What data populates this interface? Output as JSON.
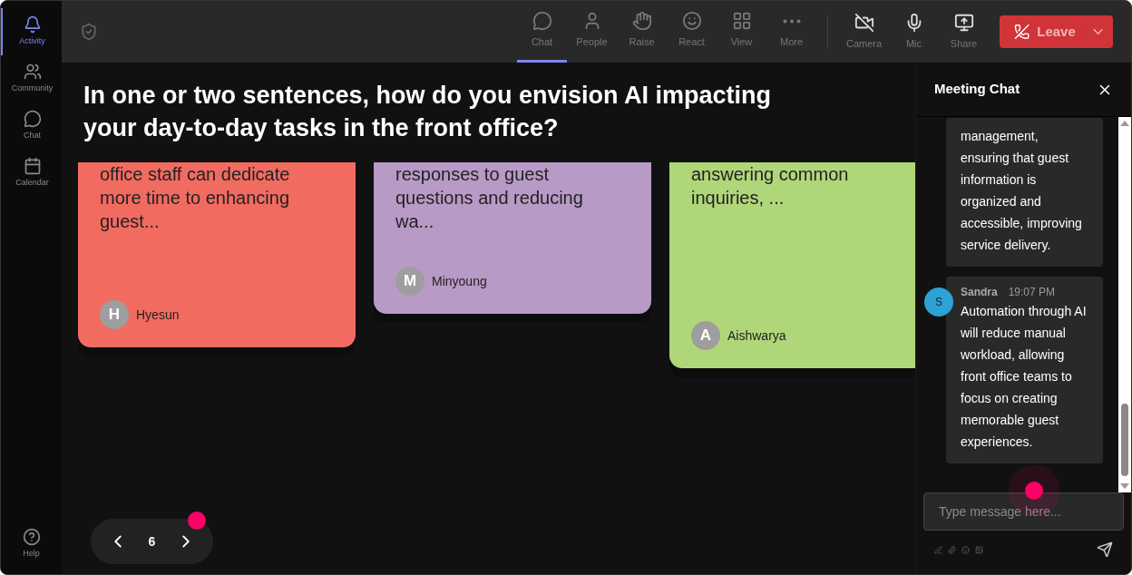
{
  "sidebar": {
    "items": [
      {
        "label": "Activity",
        "selected": true
      },
      {
        "label": "Community",
        "selected": false
      },
      {
        "label": "Chat",
        "selected": false
      },
      {
        "label": "Calendar",
        "selected": false
      }
    ],
    "help": "Help"
  },
  "toolbar": {
    "items": [
      {
        "label": "Chat",
        "selected": true
      },
      {
        "label": "People",
        "selected": false
      },
      {
        "label": "Raise",
        "selected": false
      },
      {
        "label": "React",
        "selected": false
      },
      {
        "label": "View",
        "selected": false
      },
      {
        "label": "More",
        "selected": false
      }
    ],
    "devices": [
      {
        "label": "Camera"
      },
      {
        "label": "Mic"
      },
      {
        "label": "Share"
      }
    ],
    "leave": "Leave"
  },
  "question": "In one or two sentences, how do you envision AI impacting your day-to-day tasks in the front office?",
  "cards": [
    {
      "text": "office staff can dedicate more time to enhancing guest...",
      "author": "Hyesun",
      "initial": "H",
      "color": "#f26b61"
    },
    {
      "text": "responses to guest questions and reducing wa...",
      "author": "Minyoung",
      "initial": "M",
      "color": "#b89ac6"
    },
    {
      "text": "answering common inquiries, ...",
      "author": "Aishwarya",
      "initial": "A",
      "color": "#b0d67a"
    }
  ],
  "pagination": {
    "page": "6"
  },
  "chat": {
    "title": "Meeting Chat",
    "messages": [
      {
        "text": "management, ensuring that guest information is organized and accessible, improving service delivery."
      },
      {
        "author": "Sandra",
        "time": "19:07 PM",
        "initial": "S",
        "text": "Automation through AI will reduce manual workload, allowing front office teams to focus on creating memorable guest experiences."
      }
    ],
    "input": {
      "placeholder": "Type message here..."
    }
  }
}
